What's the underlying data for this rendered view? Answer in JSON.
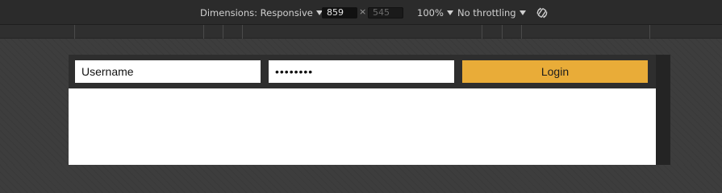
{
  "devtools": {
    "dimensions_label": "Dimensions: Responsive",
    "width_value": "859",
    "times_symbol": "×",
    "height_value": "545",
    "zoom_label": "100%",
    "throttle_label": "No throttling"
  },
  "page": {
    "username_value": "Username",
    "password_value": "••••••••",
    "login_label": "Login",
    "accent_color": "#e9ac38"
  }
}
